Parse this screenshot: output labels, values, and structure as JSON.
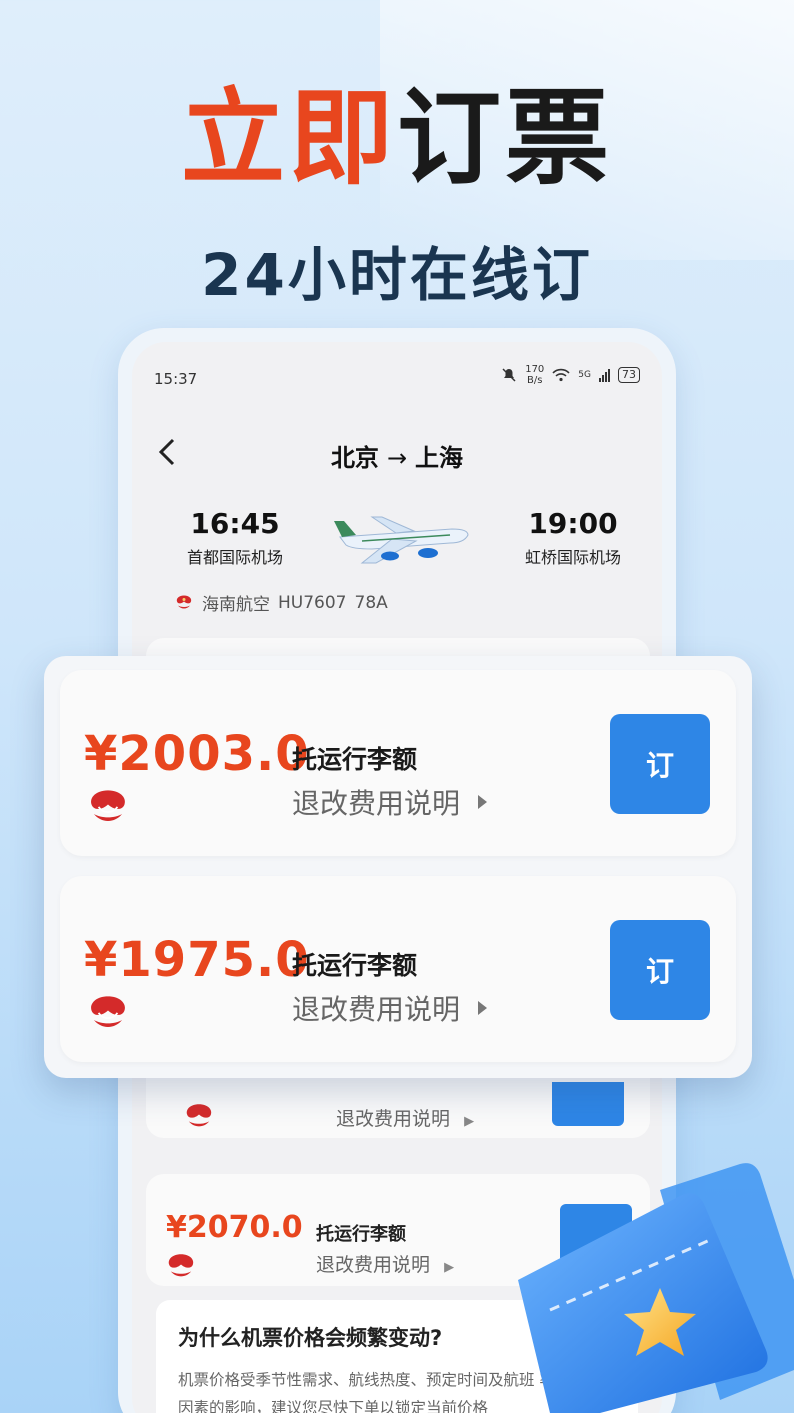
{
  "headline": {
    "part1": "立即",
    "part2": "订票"
  },
  "subline": "24小时在线订",
  "status_bar": {
    "time": "15:37",
    "net_speed_top": "170",
    "net_speed_bottom": "B/s",
    "signal_label": "5G",
    "battery": "73"
  },
  "nav": {
    "origin": "北京",
    "arrow": "→",
    "destination": "上海"
  },
  "flight": {
    "dep_time": "16:45",
    "dep_airport": "首都国际机场",
    "arr_time": "19:00",
    "arr_airport": "虹桥国际机场",
    "airline": "海南航空",
    "flight_no": "HU7607",
    "aircraft": "78A"
  },
  "overlay_fares": [
    {
      "price": "¥2003.0",
      "baggage": "托运行李额",
      "rules": "退改费用说明",
      "book": "订"
    },
    {
      "price": "¥1975.0",
      "baggage": "托运行李额",
      "rules": "退改费用说明",
      "book": "订"
    }
  ],
  "list_partial": {
    "rules": "退改费用说明"
  },
  "list_fare": {
    "price": "¥2070.0",
    "baggage": "托运行李额",
    "rules": "退改费用说明"
  },
  "faq": {
    "question": "为什么机票价格会频繁变动?",
    "answer": "机票价格受季节性需求、航线热度、预定时间及航班 率等多种因素的影响，建议您尽快下单以锁定当前价格"
  },
  "colors": {
    "accent": "#e8461e",
    "primary_button": "#2e86e6",
    "headline_dark": "#1a1a1a",
    "subline": "#1a3550"
  }
}
